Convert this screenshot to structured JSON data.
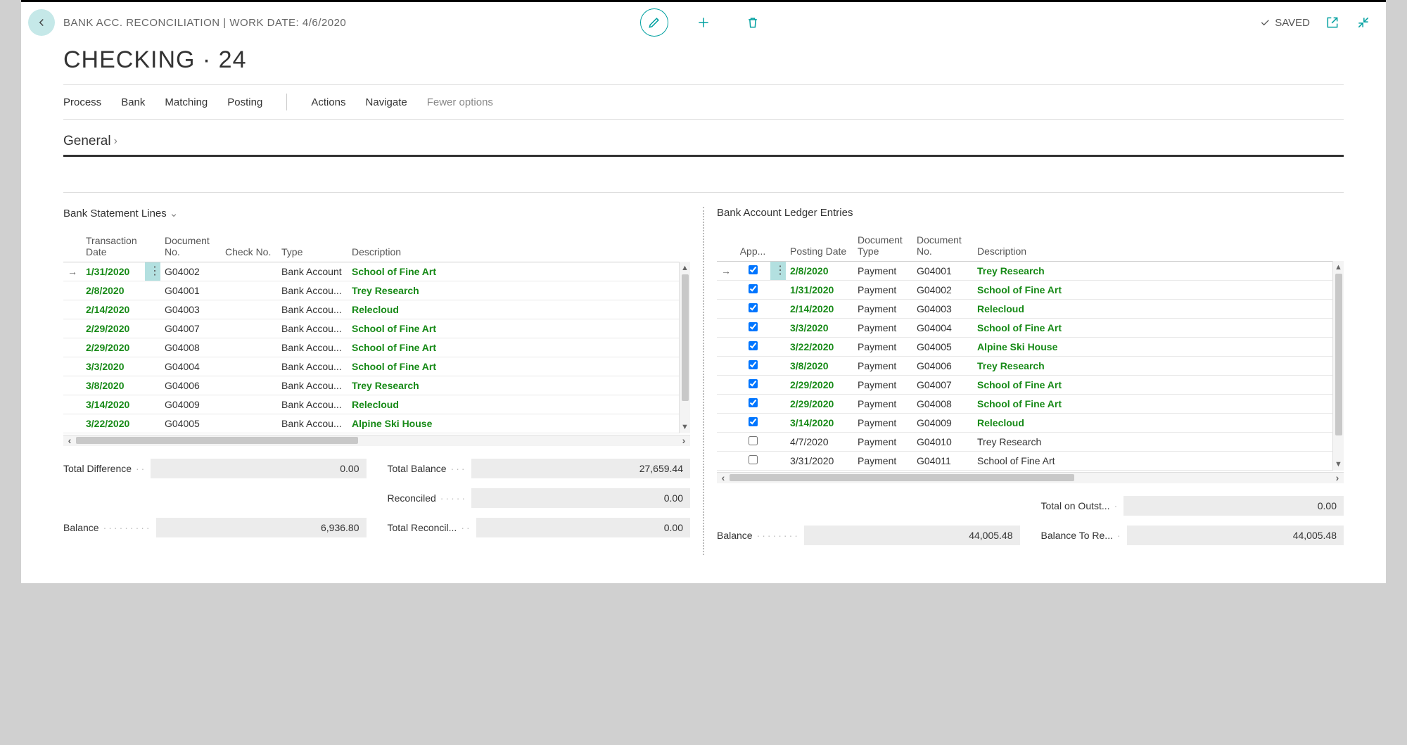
{
  "header": {
    "breadcrumb": "BANK ACC. RECONCILIATION | WORK DATE: 4/6/2020",
    "saved_label": "SAVED"
  },
  "page_title": "CHECKING · 24",
  "menu": {
    "process": "Process",
    "bank": "Bank",
    "matching": "Matching",
    "posting": "Posting",
    "actions": "Actions",
    "navigate": "Navigate",
    "fewer_options": "Fewer options"
  },
  "section": {
    "general": "General"
  },
  "left_panel": {
    "title": "Bank Statement Lines",
    "columns": {
      "trans_date": "Transaction Date",
      "doc_no": "Document No.",
      "check_no": "Check No.",
      "type": "Type",
      "description": "Description"
    },
    "rows": [
      {
        "date": "1/31/2020",
        "doc": "G04002",
        "check": "",
        "type": "Bank Account",
        "desc": "School of Fine Art",
        "matched": true,
        "selected": true
      },
      {
        "date": "2/8/2020",
        "doc": "G04001",
        "check": "",
        "type": "Bank Accou...",
        "desc": "Trey Research",
        "matched": true
      },
      {
        "date": "2/14/2020",
        "doc": "G04003",
        "check": "",
        "type": "Bank Accou...",
        "desc": "Relecloud",
        "matched": true
      },
      {
        "date": "2/29/2020",
        "doc": "G04007",
        "check": "",
        "type": "Bank Accou...",
        "desc": "School of Fine Art",
        "matched": true
      },
      {
        "date": "2/29/2020",
        "doc": "G04008",
        "check": "",
        "type": "Bank Accou...",
        "desc": "School of Fine Art",
        "matched": true
      },
      {
        "date": "3/3/2020",
        "doc": "G04004",
        "check": "",
        "type": "Bank Accou...",
        "desc": "School of Fine Art",
        "matched": true
      },
      {
        "date": "3/8/2020",
        "doc": "G04006",
        "check": "",
        "type": "Bank Accou...",
        "desc": "Trey Research",
        "matched": true
      },
      {
        "date": "3/14/2020",
        "doc": "G04009",
        "check": "",
        "type": "Bank Accou...",
        "desc": "Relecloud",
        "matched": true
      },
      {
        "date": "3/22/2020",
        "doc": "G04005",
        "check": "",
        "type": "Bank Accou...",
        "desc": "Alpine Ski House",
        "matched": true
      }
    ],
    "totals": {
      "total_difference_label": "Total Difference",
      "total_difference": "0.00",
      "balance_label": "Balance",
      "balance": "6,936.80",
      "total_balance_label": "Total Balance",
      "total_balance": "27,659.44",
      "reconciled_label": "Reconciled",
      "reconciled": "0.00",
      "total_reconcil_label": "Total Reconcil...",
      "total_reconcil": "0.00"
    }
  },
  "right_panel": {
    "title": "Bank Account Ledger Entries",
    "columns": {
      "app": "App...",
      "posting_date": "Posting Date",
      "doc_type": "Document Type",
      "doc_no": "Document No.",
      "description": "Description"
    },
    "rows": [
      {
        "app": true,
        "date": "2/8/2020",
        "dtype": "Payment",
        "dno": "G04001",
        "desc": "Trey Research",
        "matched": true,
        "selected": true
      },
      {
        "app": true,
        "date": "1/31/2020",
        "dtype": "Payment",
        "dno": "G04002",
        "desc": "School of Fine Art",
        "matched": true
      },
      {
        "app": true,
        "date": "2/14/2020",
        "dtype": "Payment",
        "dno": "G04003",
        "desc": "Relecloud",
        "matched": true
      },
      {
        "app": true,
        "date": "3/3/2020",
        "dtype": "Payment",
        "dno": "G04004",
        "desc": "School of Fine Art",
        "matched": true
      },
      {
        "app": true,
        "date": "3/22/2020",
        "dtype": "Payment",
        "dno": "G04005",
        "desc": "Alpine Ski House",
        "matched": true
      },
      {
        "app": true,
        "date": "3/8/2020",
        "dtype": "Payment",
        "dno": "G04006",
        "desc": "Trey Research",
        "matched": true
      },
      {
        "app": true,
        "date": "2/29/2020",
        "dtype": "Payment",
        "dno": "G04007",
        "desc": "School of Fine Art",
        "matched": true
      },
      {
        "app": true,
        "date": "2/29/2020",
        "dtype": "Payment",
        "dno": "G04008",
        "desc": "School of Fine Art",
        "matched": true
      },
      {
        "app": true,
        "date": "3/14/2020",
        "dtype": "Payment",
        "dno": "G04009",
        "desc": "Relecloud",
        "matched": true
      },
      {
        "app": false,
        "date": "4/7/2020",
        "dtype": "Payment",
        "dno": "G04010",
        "desc": "Trey Research",
        "matched": false
      },
      {
        "app": false,
        "date": "3/31/2020",
        "dtype": "Payment",
        "dno": "G04011",
        "desc": "School of Fine Art",
        "matched": false
      }
    ],
    "totals": {
      "balance_label": "Balance",
      "balance": "44,005.48",
      "total_outst_label": "Total on Outst...",
      "total_outst": "0.00",
      "balance_to_re_label": "Balance To Re...",
      "balance_to_re": "44,005.48"
    }
  }
}
